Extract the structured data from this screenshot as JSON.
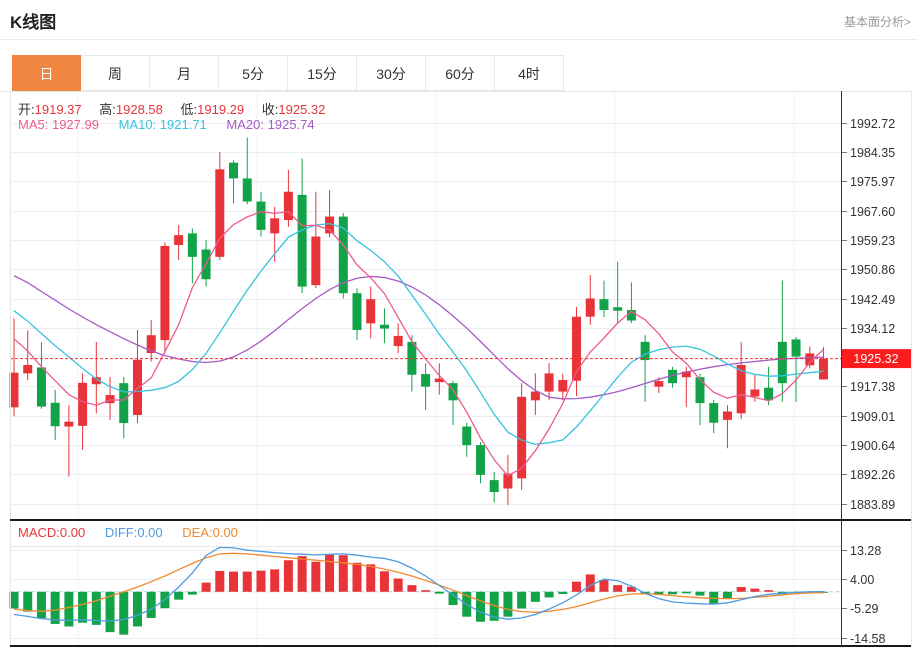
{
  "header": {
    "title": "K线图",
    "link_label": "基本面分析>"
  },
  "tabs": {
    "items": [
      "日",
      "周",
      "月",
      "5分",
      "15分",
      "30分",
      "60分",
      "4时"
    ],
    "active_index": 0
  },
  "overlay": {
    "ohlc": {
      "open_label": "开:",
      "open_value": "1919.37",
      "high_label": "高:",
      "high_value": "1928.58",
      "low_label": "低:",
      "low_value": "1919.29",
      "close_label": "收:",
      "close_value": "1925.32"
    },
    "ma": {
      "ma5_label": "MA5:",
      "ma5_value": "1927.99",
      "ma10_label": "MA10:",
      "ma10_value": "1921.71",
      "ma20_label": "MA20:",
      "ma20_value": "1925.74"
    },
    "macd": {
      "macd_label": "MACD:",
      "macd_value": "0.00",
      "diff_label": "DIFF:",
      "diff_value": "0.00",
      "dea_label": "DEA:",
      "dea_value": "0.00"
    }
  },
  "colors": {
    "up": "#e83438",
    "down": "#12a348",
    "ma5": "#ef5a8f",
    "ma10": "#38c2e0",
    "ma20": "#a55ac5",
    "diff": "#4f9be0",
    "dea": "#f08a2e",
    "last_price_line": "#f23030",
    "tag_bg": "#fb1d1d",
    "tag_text": "#ffffff",
    "zero_line": "#a8d7ee",
    "grid": "#e9eef5",
    "vgrid": "#eff3f8",
    "axis_line": "#333333",
    "dark_border": "#1a1a1a",
    "light_border": "#e7e7e7",
    "label_text": "#333333",
    "tick": "#777777",
    "tab_active_bg": "#f0863f",
    "link_text": "#999999"
  },
  "chart_data": {
    "type": "candlestick+macd",
    "title": "K线图",
    "legend": [
      "MA5",
      "MA10",
      "MA20",
      "MACD",
      "DIFF",
      "DEA"
    ],
    "price_axis_ticks": [
      "1992.72",
      "1984.35",
      "1975.97",
      "1967.60",
      "1959.23",
      "1950.86",
      "1942.49",
      "1934.12",
      "1925.32",
      "1917.38",
      "1909.01",
      "1900.64",
      "1892.26",
      "1883.89"
    ],
    "last_price_tag": "1925.32",
    "macd_axis_ticks": [
      "13.28",
      "4.00",
      "-5.29",
      "-14.58"
    ],
    "price_ylim": [
      1879.49,
      2001.21
    ],
    "macd_ylim": [
      -17.2,
      14.2
    ],
    "x_gridlines": [
      78,
      257,
      436,
      615,
      794
    ],
    "candles": [
      [
        1911.4,
        1936.8,
        1908.9,
        1921.3
      ],
      [
        1921.1,
        1933.4,
        1919.2,
        1923.5
      ],
      [
        1922.8,
        1930.0,
        1911.0,
        1911.6
      ],
      [
        1912.7,
        1916.4,
        1902.1,
        1906.0
      ],
      [
        1905.9,
        1912.0,
        1891.6,
        1907.3
      ],
      [
        1906.1,
        1921.1,
        1899.2,
        1918.4
      ],
      [
        1918.0,
        1930.1,
        1909.7,
        1920.0
      ],
      [
        1912.6,
        1920.1,
        1907.8,
        1914.9
      ],
      [
        1918.3,
        1920.1,
        1902.6,
        1906.9
      ],
      [
        1909.2,
        1933.5,
        1906.9,
        1925.0
      ],
      [
        1926.9,
        1936.3,
        1924.5,
        1932.0
      ],
      [
        1930.6,
        1958.5,
        1926.9,
        1957.5
      ],
      [
        1957.8,
        1963.5,
        1953.5,
        1960.6
      ],
      [
        1961.1,
        1962.5,
        1946.8,
        1954.4
      ],
      [
        1956.5,
        1959.2,
        1945.9,
        1948.0
      ],
      [
        1954.4,
        1984.4,
        1953.5,
        1979.4
      ],
      [
        1981.3,
        1982.0,
        1969.7,
        1976.8
      ],
      [
        1976.8,
        1988.5,
        1969.5,
        1970.2
      ],
      [
        1970.2,
        1973.0,
        1960.2,
        1962.1
      ],
      [
        1961.1,
        1968.7,
        1953.0,
        1965.4
      ],
      [
        1964.9,
        1979.2,
        1963.0,
        1973.0
      ],
      [
        1972.1,
        1982.5,
        1944.0,
        1945.9
      ],
      [
        1946.3,
        1973.0,
        1945.5,
        1960.2
      ],
      [
        1961.1,
        1973.5,
        1960.0,
        1965.9
      ],
      [
        1965.9,
        1966.9,
        1942.5,
        1944.0
      ],
      [
        1944.0,
        1945.4,
        1930.6,
        1933.5
      ],
      [
        1935.4,
        1945.9,
        1931.1,
        1942.3
      ],
      [
        1935.0,
        1939.7,
        1929.7,
        1933.9
      ],
      [
        1928.9,
        1935.4,
        1926.8,
        1931.8
      ],
      [
        1930.1,
        1932.0,
        1915.9,
        1920.7
      ],
      [
        1920.9,
        1924.0,
        1910.6,
        1917.3
      ],
      [
        1918.6,
        1924.0,
        1915.0,
        1919.6
      ],
      [
        1918.3,
        1919.0,
        1906.3,
        1913.4
      ],
      [
        1905.9,
        1907.0,
        1897.3,
        1900.6
      ],
      [
        1900.6,
        1901.5,
        1889.7,
        1892.1
      ],
      [
        1890.6,
        1893.0,
        1884.2,
        1887.2
      ],
      [
        1888.2,
        1897.8,
        1883.5,
        1892.5
      ],
      [
        1891.1,
        1918.3,
        1887.8,
        1914.4
      ],
      [
        1913.4,
        1921.1,
        1909.2,
        1915.9
      ],
      [
        1915.9,
        1924.0,
        1913.4,
        1921.1
      ],
      [
        1915.9,
        1921.0,
        1913.4,
        1919.2
      ],
      [
        1919.0,
        1940.1,
        1914.6,
        1937.3
      ],
      [
        1937.3,
        1949.2,
        1935.0,
        1942.5
      ],
      [
        1942.3,
        1947.6,
        1937.2,
        1939.2
      ],
      [
        1940.0,
        1953.0,
        1935.4,
        1939.0
      ],
      [
        1939.2,
        1947.1,
        1935.5,
        1936.2
      ],
      [
        1930.1,
        1932.0,
        1913.0,
        1924.9
      ],
      [
        1917.3,
        1920.0,
        1915.5,
        1918.9
      ],
      [
        1922.1,
        1923.0,
        1917.0,
        1918.3
      ],
      [
        1920.0,
        1923.0,
        1911.5,
        1921.6
      ],
      [
        1920.0,
        1921.0,
        1906.3,
        1912.6
      ],
      [
        1912.6,
        1913.5,
        1904.0,
        1907.0
      ],
      [
        1907.8,
        1912.0,
        1899.7,
        1910.2
      ],
      [
        1909.7,
        1930.1,
        1908.0,
        1923.5
      ],
      [
        1914.5,
        1920.7,
        1913.0,
        1916.5
      ],
      [
        1917.0,
        1923.0,
        1912.0,
        1913.4
      ],
      [
        1930.1,
        1947.6,
        1913.0,
        1918.3
      ],
      [
        1930.8,
        1931.5,
        1912.9,
        1925.9
      ],
      [
        1923.4,
        1928.8,
        1922.5,
        1926.8
      ],
      [
        1919.37,
        1928.58,
        1919.29,
        1925.32
      ]
    ],
    "ma5": [
      1931.0,
      1927.5,
      1923.0,
      1919.0,
      1915.0,
      1913.0,
      1912.0,
      1913.5,
      1913.5,
      1916.8,
      1919.8,
      1927.3,
      1935.0,
      1945.6,
      1952.4,
      1959.7,
      1963.6,
      1965.8,
      1967.3,
      1966.8,
      1967.3,
      1963.3,
      1963.4,
      1962.1,
      1957.8,
      1952.1,
      1948.4,
      1943.9,
      1937.1,
      1930.2,
      1925.2,
      1920.5,
      1916.4,
      1910.0,
      1902.6,
      1896.4,
      1891.8,
      1894.0,
      1899.0,
      1905.2,
      1912.5,
      1921.6,
      1927.2,
      1931.2,
      1935.5,
      1938.8,
      1936.4,
      1932.4,
      1927.2,
      1924.0,
      1919.3,
      1915.7,
      1914.0,
      1915.0,
      1914.2,
      1913.3,
      1915.3,
      1919.2,
      1924.2,
      1927.99
    ],
    "ma10": [
      1939.0,
      1936.0,
      1932.5,
      1929.0,
      1925.8,
      1922.5,
      1919.5,
      1917.3,
      1915.8,
      1915.9,
      1916.3,
      1917.0,
      1918.8,
      1922.2,
      1926.8,
      1932.7,
      1938.9,
      1944.9,
      1950.3,
      1955.3,
      1960.0,
      1962.1,
      1963.5,
      1963.9,
      1962.6,
      1959.0,
      1956.2,
      1953.0,
      1948.9,
      1943.5,
      1938.0,
      1932.3,
      1927.2,
      1921.8,
      1915.7,
      1909.4,
      1904.3,
      1902.0,
      1900.8,
      1901.3,
      1902.1,
      1905.8,
      1910.4,
      1915.2,
      1920.0,
      1924.3,
      1926.6,
      1927.9,
      1928.6,
      1928.9,
      1928.0,
      1926.1,
      1923.8,
      1921.9,
      1920.8,
      1920.3,
      1920.4,
      1920.9,
      1921.3,
      1921.71
    ],
    "ma20": [
      1949.0,
      1947.0,
      1944.5,
      1942.0,
      1939.5,
      1937.2,
      1935.0,
      1933.0,
      1931.0,
      1929.2,
      1927.5,
      1926.2,
      1925.2,
      1924.5,
      1924.2,
      1924.6,
      1925.8,
      1927.8,
      1930.3,
      1933.3,
      1936.5,
      1939.6,
      1942.5,
      1945.0,
      1947.0,
      1948.3,
      1948.8,
      1948.5,
      1947.5,
      1945.8,
      1943.5,
      1940.7,
      1937.5,
      1934.0,
      1930.2,
      1926.3,
      1922.4,
      1919.0,
      1916.2,
      1914.3,
      1913.8,
      1913.9,
      1914.3,
      1915.0,
      1915.9,
      1917.0,
      1918.2,
      1919.4,
      1920.5,
      1921.5,
      1922.3,
      1923.0,
      1923.6,
      1924.1,
      1924.5,
      1924.9,
      1925.2,
      1925.4,
      1925.6,
      1925.74
    ],
    "macd_hist": [
      -5.3,
      -6.3,
      -8.4,
      -10.2,
      -11.0,
      -9.8,
      -10.5,
      -12.8,
      -13.6,
      -11.0,
      -8.3,
      -5.2,
      -2.5,
      -0.9,
      2.9,
      6.6,
      6.4,
      6.4,
      6.7,
      7.1,
      10.0,
      11.3,
      9.5,
      11.9,
      11.6,
      9.2,
      8.7,
      6.5,
      4.2,
      2.1,
      0.5,
      -0.6,
      -4.2,
      -7.9,
      -9.5,
      -9.2,
      -7.9,
      -5.3,
      -3.2,
      -1.8,
      -0.7,
      3.2,
      5.5,
      3.7,
      2.1,
      1.6,
      -0.8,
      -1.0,
      -0.8,
      -0.5,
      -1.2,
      -3.7,
      -2.1,
      1.5,
      1.0,
      0.5,
      -0.8,
      -0.2,
      -0.1,
      -0.1
    ],
    "diff": [
      -7.2,
      -7.8,
      -8.5,
      -8.9,
      -9.1,
      -8.9,
      -9.1,
      -9.3,
      -8.8,
      -7.5,
      -5.5,
      -2.5,
      1.5,
      6.0,
      11.5,
      14.1,
      13.9,
      13.2,
      12.8,
      12.4,
      12.1,
      11.9,
      11.7,
      11.9,
      12.0,
      11.6,
      11.0,
      10.6,
      9.5,
      7.5,
      5.0,
      2.0,
      -1.0,
      -4.0,
      -6.5,
      -8.0,
      -8.7,
      -8.3,
      -7.2,
      -5.5,
      -3.5,
      -1.0,
      2.0,
      4.0,
      3.5,
      1.8,
      -0.5,
      -2.2,
      -3.2,
      -3.6,
      -3.8,
      -3.9,
      -3.5,
      -2.5,
      -1.5,
      -0.8,
      -0.5,
      -0.2,
      0.0,
      0.1
    ],
    "dea": [
      -5.5,
      -6.0,
      -6.2,
      -5.8,
      -5.0,
      -4.0,
      -2.8,
      -1.4,
      0.0,
      1.5,
      3.2,
      5.0,
      7.0,
      9.0,
      10.8,
      12.0,
      12.2,
      12.0,
      11.6,
      11.2,
      10.8,
      10.4,
      10.0,
      9.6,
      9.2,
      8.7,
      8.0,
      7.2,
      6.2,
      5.0,
      3.6,
      2.1,
      0.5,
      -1.2,
      -2.9,
      -4.4,
      -5.6,
      -6.3,
      -6.5,
      -6.2,
      -5.6,
      -4.7,
      -3.5,
      -2.3,
      -1.3,
      -0.7,
      -0.6,
      -0.8,
      -1.2,
      -1.6,
      -1.9,
      -2.1,
      -2.2,
      -2.1,
      -1.8,
      -1.4,
      -1.0,
      -0.6,
      -0.4,
      -0.3
    ]
  }
}
